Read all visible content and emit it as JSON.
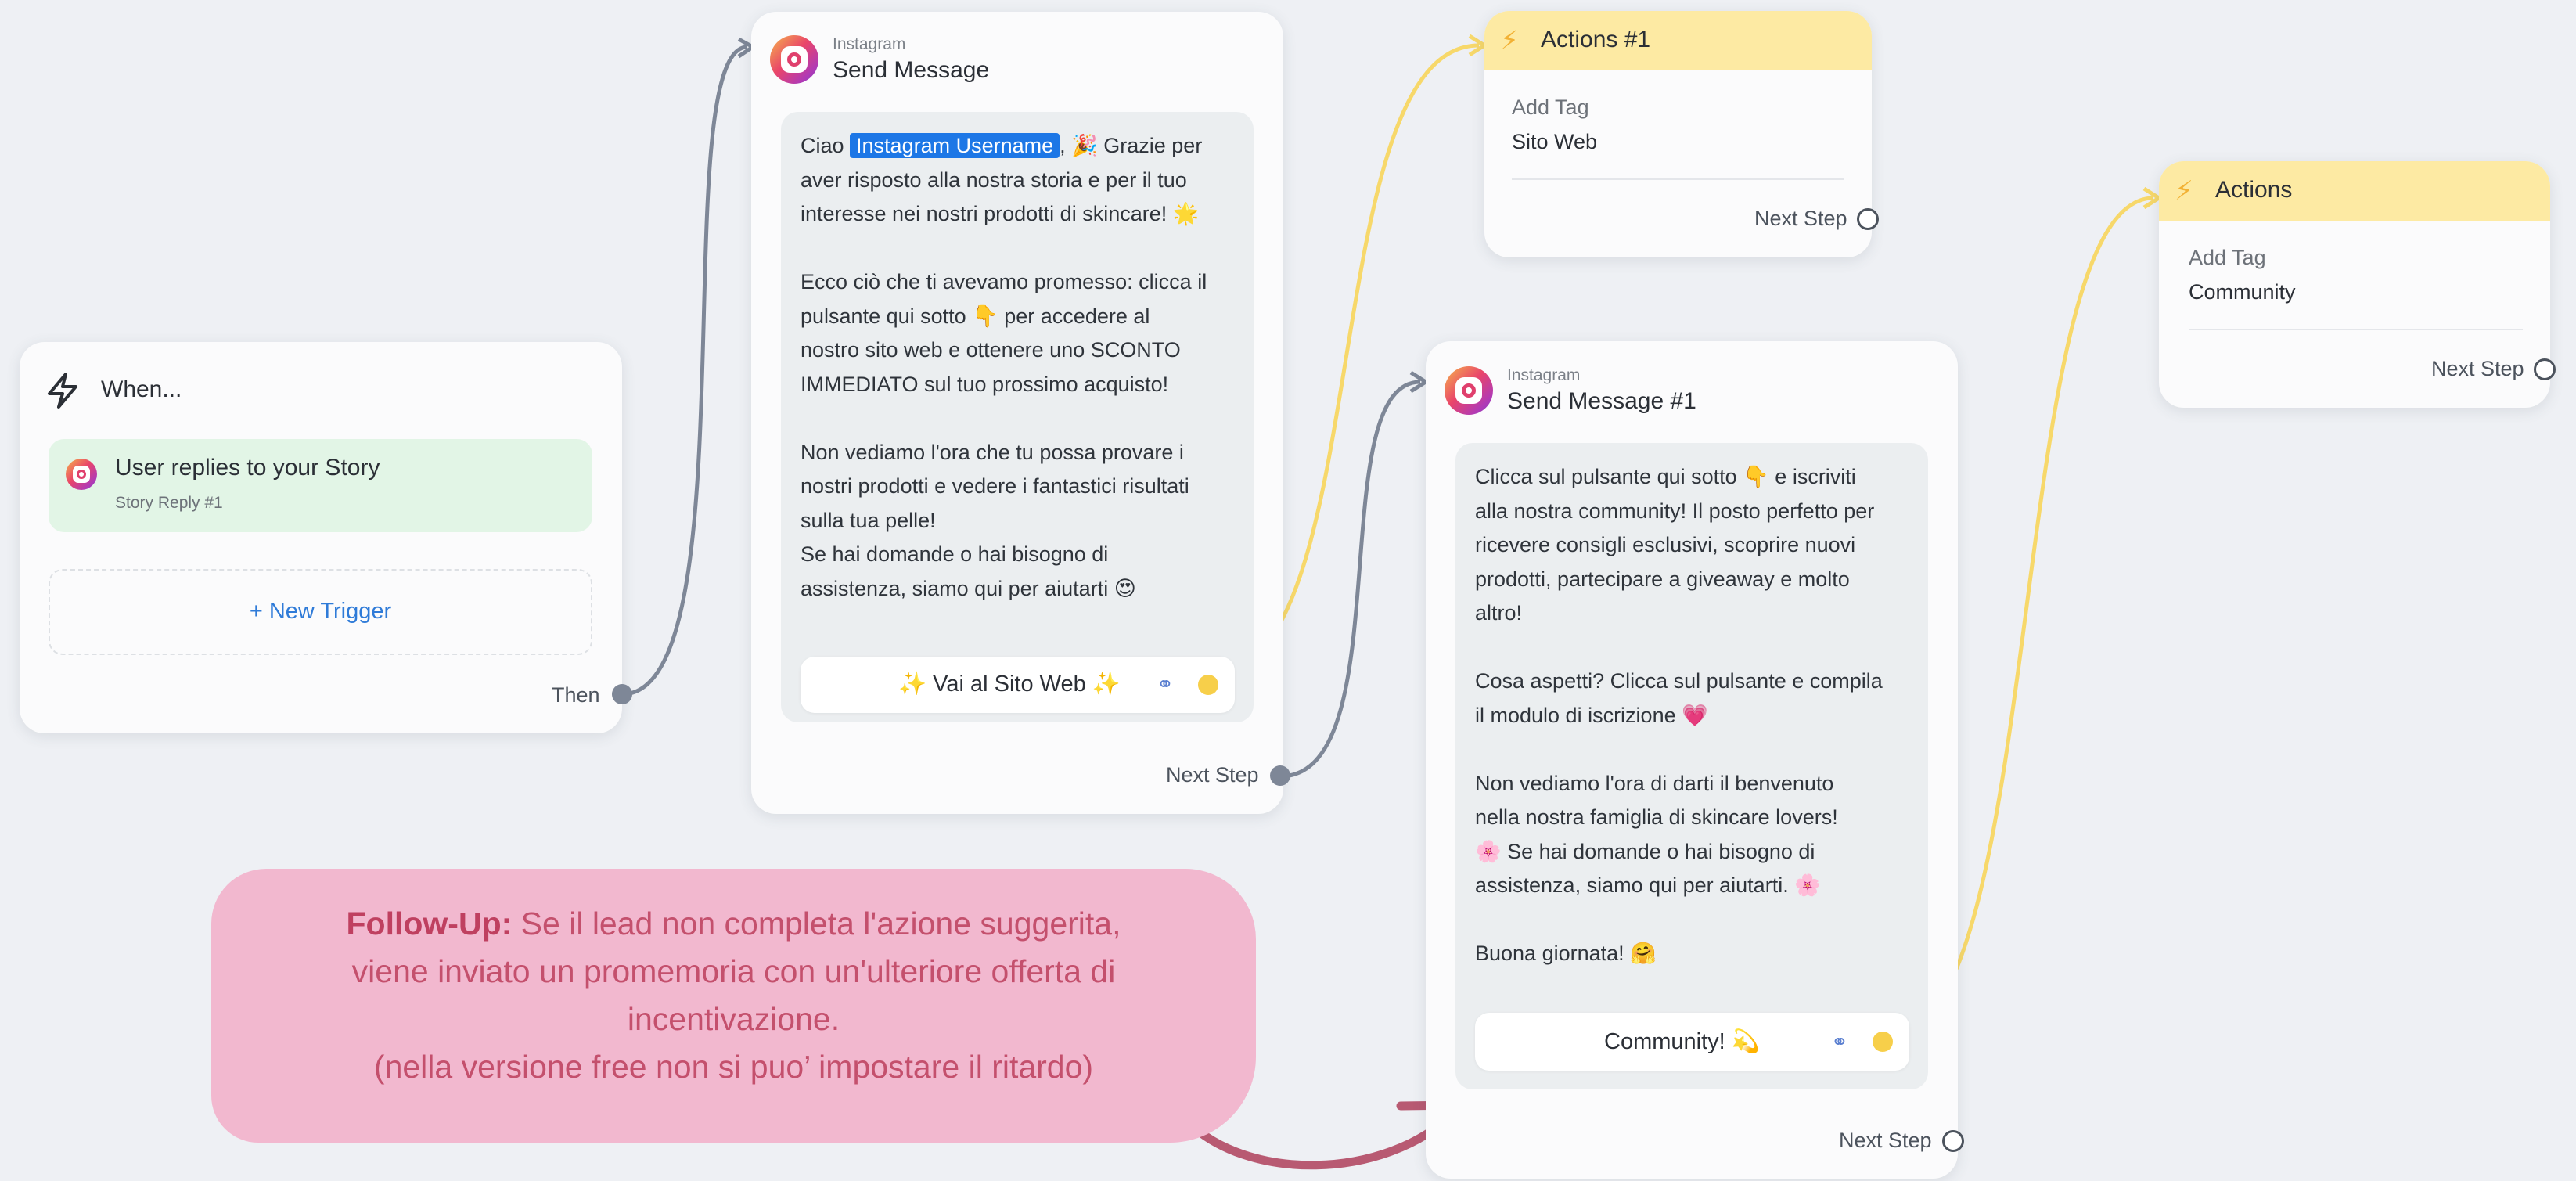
{
  "trigger_card": {
    "title": "When...",
    "trigger_label": "User replies to your Story",
    "trigger_sub": "Story Reply #1",
    "new_trigger": "+ New Trigger",
    "then_label": "Then"
  },
  "send_message_1": {
    "platform": "Instagram",
    "title": "Send Message",
    "message_prefix": "Ciao ",
    "username_chip": "Instagram Username",
    "message_rest": ", 🎉 Grazie per\naver risposto alla nostra storia e per il tuo\ninteresse nei nostri prodotti di skincare! 🌟\n\nEcco ciò che ti avevamo promesso: clicca il\npulsante qui sotto 👇 per accedere al\nnostro sito web e ottenere uno SCONTO\nIMMEDIATO sul tuo prossimo acquisto!\n\nNon vediamo l'ora che tu possa provare i\nnostri prodotti e vedere i fantastici risultati\nsulla tua pelle!\nSe hai domande o hai bisogno di\nassistenza, siamo qui per aiutarti 😍",
    "button_label": "✨ Vai al Sito Web ✨",
    "next_step": "Next Step"
  },
  "actions_1": {
    "title": "Actions #1",
    "action_type": "Add Tag",
    "action_value": "Sito Web",
    "next_step": "Next Step"
  },
  "send_message_2": {
    "platform": "Instagram",
    "title": "Send Message #1",
    "message": "Clicca sul pulsante qui sotto 👇 e iscriviti\nalla nostra community! Il posto perfetto per\nricevere consigli esclusivi, scoprire nuovi\nprodotti, partecipare a giveaway e molto\naltro!\n\nCosa aspetti? Clicca sul pulsante e compila\nil modulo di iscrizione 💗\n\nNon vediamo l'ora di darti il benvenuto\nnella nostra famiglia di skincare lovers!\n🌸 Se hai domande o hai bisogno di\nassistenza, siamo qui per aiutarti. 🌸\n\nBuona giornata! 🤗",
    "button_label": "Community! 💫",
    "next_step": "Next Step"
  },
  "actions_2": {
    "title": "Actions",
    "action_type": "Add Tag",
    "action_value": "Community",
    "next_step": "Next Step"
  },
  "followup_note": {
    "bold": "Follow-Up:",
    "line1": " Se il lead non completa l'azione suggerita,",
    "line2": "viene inviato un promemoria con un'ulteriore offerta di",
    "line3": "incentivazione.",
    "line4": "(nella versione free non si puo’ impostare il ritardo)"
  },
  "colors": {
    "canvas_bg": "#eef0f4",
    "trigger_bg": "#e2f5e6",
    "actions_header": "#fdeaa3",
    "connector_gray": "#7e8797",
    "connector_yellow": "#f7d86a",
    "username_chip": "#1d77e6",
    "note_bg": "#f2b8cf",
    "note_text": "#c4506d",
    "arrow": "#b85a72"
  },
  "icons": [
    "lightning-icon",
    "instagram-icon",
    "link-icon",
    "bolt-icon",
    "curved-arrow-icon"
  ]
}
